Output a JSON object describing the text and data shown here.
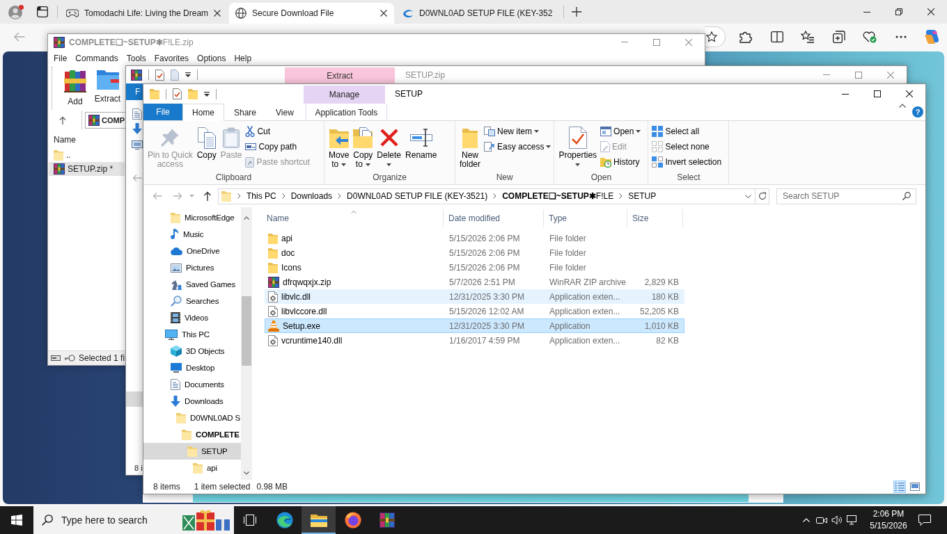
{
  "browser": {
    "tabs": [
      {
        "title": "Tomodachi Life: Living the Dream",
        "selected": false,
        "closable": true
      },
      {
        "title": "Secure Download File",
        "selected": true,
        "closable": true
      },
      {
        "title": "D0WNL0AD SETUP FILE (KEY-352",
        "selected": false,
        "closable": false
      }
    ]
  },
  "winrar": {
    "title": "**COMPLETE❏~SETUP✱**F!LE.zip",
    "menu": [
      "File",
      "Commands",
      "Tools",
      "Favorites",
      "Options",
      "Help"
    ],
    "toolbar": [
      "Add",
      "Extract"
    ],
    "path": "COMP",
    "column": "Name",
    "rows": [
      {
        "name": "..",
        "kind": "parent",
        "selected": false
      },
      {
        "name": "SETUP.zip *",
        "kind": "archive",
        "selected": true
      }
    ],
    "status": "Selected 1 fi"
  },
  "archive_window": {
    "context_tab": "Extract",
    "title": "SETUP.zip",
    "file_tab": "F",
    "status": "8 i"
  },
  "explorer": {
    "context_tab": "Manage",
    "title": "SETUP",
    "ribbon_tabs": [
      {
        "label": "File",
        "kind": "file",
        "selected": false
      },
      {
        "label": "Home",
        "kind": "tab",
        "selected": true
      },
      {
        "label": "Share",
        "kind": "tab",
        "selected": false
      },
      {
        "label": "View",
        "kind": "tab",
        "selected": false
      },
      {
        "label": "Application Tools",
        "kind": "context",
        "selected": false
      }
    ],
    "help": "?",
    "groups": [
      {
        "label": "Clipboard",
        "commands": [
          {
            "label": "Pin to Quick access",
            "kind": "large",
            "disabled": true,
            "menu": false
          },
          {
            "label": "Copy",
            "kind": "large",
            "disabled": false,
            "menu": false
          },
          {
            "label": "Paste",
            "kind": "large",
            "disabled": true,
            "menu": false
          },
          {
            "label": "Cut",
            "kind": "small",
            "disabled": false,
            "menu": false
          },
          {
            "label": "Copy path",
            "kind": "small",
            "disabled": false,
            "menu": false
          },
          {
            "label": "Paste shortcut",
            "kind": "small",
            "disabled": true,
            "menu": false
          }
        ]
      },
      {
        "label": "Organize",
        "commands": [
          {
            "label": "Move to",
            "kind": "large",
            "disabled": false,
            "menu": true
          },
          {
            "label": "Copy to",
            "kind": "large",
            "disabled": false,
            "menu": true
          },
          {
            "label": "Delete",
            "kind": "large",
            "disabled": false,
            "menu": true
          },
          {
            "label": "Rename",
            "kind": "large",
            "disabled": false,
            "menu": false
          }
        ]
      },
      {
        "label": "New",
        "commands": [
          {
            "label": "New folder",
            "kind": "large",
            "disabled": false,
            "menu": false
          },
          {
            "label": "New item",
            "kind": "small",
            "disabled": false,
            "menu": true
          },
          {
            "label": "Easy access",
            "kind": "small",
            "disabled": false,
            "menu": true
          }
        ]
      },
      {
        "label": "Open",
        "commands": [
          {
            "label": "Properties",
            "kind": "large",
            "disabled": false,
            "menu": true
          },
          {
            "label": "Open",
            "kind": "small",
            "disabled": false,
            "menu": true
          },
          {
            "label": "Edit",
            "kind": "small",
            "disabled": true,
            "menu": false
          },
          {
            "label": "History",
            "kind": "small",
            "disabled": false,
            "menu": false
          }
        ]
      },
      {
        "label": "Select",
        "commands": [
          {
            "label": "Select all",
            "kind": "small",
            "disabled": false,
            "menu": false
          },
          {
            "label": "Select none",
            "kind": "small",
            "disabled": false,
            "menu": false
          },
          {
            "label": "Invert selection",
            "kind": "small",
            "disabled": false,
            "menu": false
          }
        ]
      }
    ],
    "address": {
      "crumbs": [
        "This PC",
        "Downloads",
        "D0WNL0AD SETUP FILE (KEY-3521)",
        "**COMPLETE❏~SETUP✱**F!LE",
        "SETUP"
      ]
    },
    "search": {
      "placeholder": "Search SETUP"
    },
    "nav_pane": {
      "items": [
        {
          "children": [
            {
              "label": "MicrosoftEdge",
              "kind": "folder",
              "selected": false,
              "bold": false
            },
            {
              "label": "Music",
              "kind": "music",
              "selected": false,
              "bold": false
            },
            {
              "label": "OneDrive",
              "kind": "cloud",
              "selected": false,
              "bold": false
            },
            {
              "label": "Pictures",
              "kind": "pictures",
              "selected": false,
              "bold": false
            },
            {
              "label": "Saved Games",
              "kind": "games",
              "selected": false,
              "bold": false
            },
            {
              "label": "Searches",
              "kind": "searches",
              "selected": false,
              "bold": false
            },
            {
              "label": "Videos",
              "kind": "videos",
              "selected": false,
              "bold": false
            }
          ]
        },
        {
          "label": "This PC",
          "kind": "computer",
          "selected": false,
          "bold": false,
          "children": [
            {
              "label": "3D Objects",
              "kind": "objects",
              "selected": false,
              "bold": false
            },
            {
              "label": "Desktop",
              "kind": "desktop",
              "selected": false,
              "bold": false
            },
            {
              "label": "Documents",
              "kind": "documents",
              "selected": false,
              "bold": false
            },
            {
              "label": "Downloads",
              "kind": "downloads",
              "selected": false,
              "bold": false,
              "children": [
                {
                  "label": "D0WNL0AD S",
                  "kind": "folder",
                  "selected": false,
                  "bold": false,
                  "children": [
                    {
                      "label": "COMPLETE",
                      "kind": "folder",
                      "selected": false,
                      "bold": true,
                      "children": [
                        {
                          "label": "SETUP",
                          "kind": "folder",
                          "selected": true,
                          "bold": false,
                          "children": [
                            {
                              "label": "api",
                              "kind": "folder",
                              "selected": false,
                              "bold": false
                            }
                          ]
                        }
                      ]
                    }
                  ]
                }
              ]
            }
          ]
        }
      ]
    },
    "file_list": {
      "columns": [
        {
          "label": "Name",
          "sorted": true
        },
        {
          "label": "Date modified",
          "sorted": false
        },
        {
          "label": "Type",
          "sorted": false
        },
        {
          "label": "Size",
          "sorted": false
        }
      ],
      "rows": [
        {
          "name": "api",
          "date": "5/15/2026 2:06 PM",
          "type": "File folder",
          "kind": "folder",
          "selected": false,
          "hovered": false
        },
        {
          "name": "doc",
          "date": "5/15/2026 2:06 PM",
          "type": "File folder",
          "kind": "folder",
          "selected": false,
          "hovered": false
        },
        {
          "name": "Icons",
          "date": "5/15/2026 2:06 PM",
          "type": "File folder",
          "kind": "folder",
          "selected": false,
          "hovered": false
        },
        {
          "name": "dfrqwqxjx.zip",
          "date": "5/7/2026 2:51 PM",
          "type": "WinRAR ZIP archive",
          "size": "2,829 KB",
          "kind": "archive",
          "selected": false,
          "hovered": false
        },
        {
          "name": "libvlc.dll",
          "date": "12/31/2025 3:30 PM",
          "type": "Application exten...",
          "size": "180 KB",
          "kind": "library",
          "selected": false,
          "hovered": true
        },
        {
          "name": "libvlccore.dll",
          "date": "5/15/2026 12:02 AM",
          "type": "Application exten...",
          "size": "52,205 KB",
          "kind": "library",
          "selected": false,
          "hovered": false
        },
        {
          "name": "Setup.exe",
          "date": "12/31/2025 3:30 PM",
          "type": "Application",
          "size": "1,010 KB",
          "kind": "application",
          "selected": true,
          "hovered": false
        },
        {
          "name": "vcruntime140.dll",
          "date": "1/16/2017 4:59 PM",
          "type": "Application exten...",
          "size": "82 KB",
          "kind": "library",
          "selected": false,
          "hovered": false
        }
      ]
    },
    "status_bar": {
      "count": "8 items",
      "selection": "1 item selected",
      "size": "0.98 MB"
    },
    "view_buttons": [
      {
        "kind": "details",
        "selected": true
      },
      {
        "kind": "tiles",
        "selected": false
      }
    ]
  },
  "taskbar": {
    "search": {
      "placeholder": "Type here to search"
    },
    "apps": [
      {
        "active": false
      },
      {
        "active": true
      },
      {
        "active": false
      },
      {
        "active": false
      }
    ],
    "clock": {
      "time": "2:06 PM",
      "date": "5/15/2026"
    }
  }
}
